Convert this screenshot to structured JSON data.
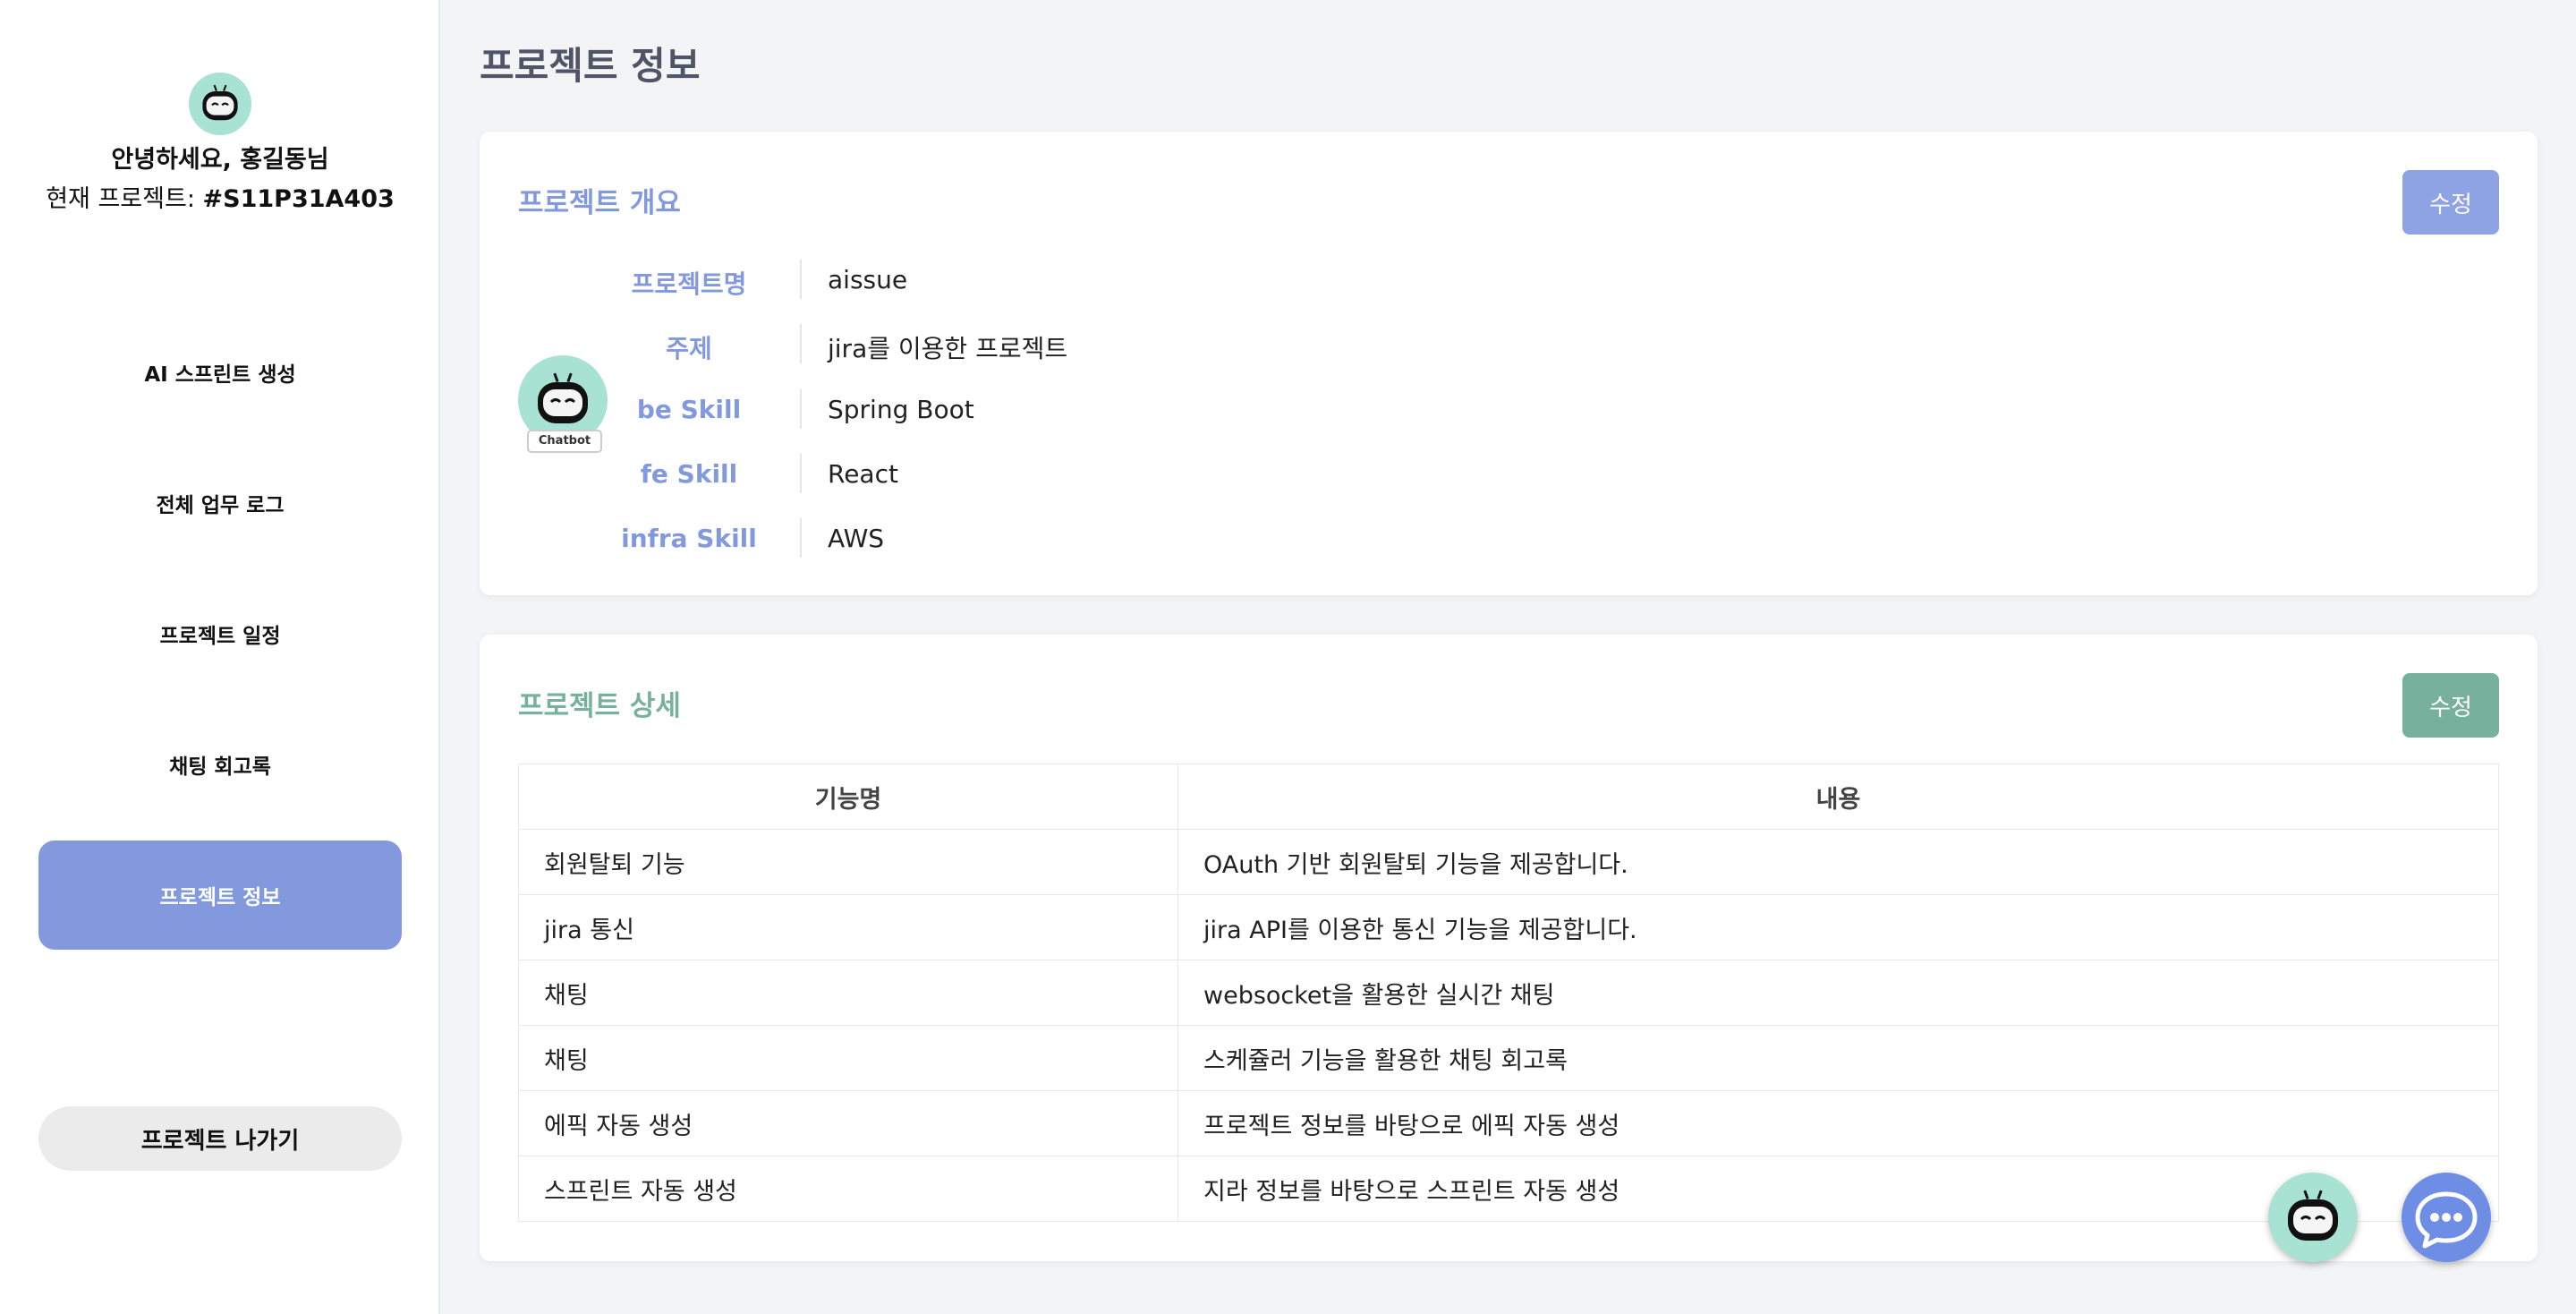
{
  "sidebar": {
    "greeting": "안녕하세요, 홍길동님",
    "project_prefix": "현재 프로젝트: ",
    "project_code": "#S11P31A403",
    "nav": [
      {
        "label": "AI 스프린트 생성",
        "active": false
      },
      {
        "label": "전체 업무 로그",
        "active": false
      },
      {
        "label": "프로젝트 일정",
        "active": false
      },
      {
        "label": "채팅 회고록",
        "active": false
      },
      {
        "label": "프로젝트 정보",
        "active": true
      }
    ],
    "leave_label": "프로젝트 나가기"
  },
  "page": {
    "title": "프로젝트 정보"
  },
  "overview": {
    "title": "프로젝트 개요",
    "edit_label": "수정",
    "badge_label": "Chatbot",
    "rows": [
      {
        "label": "프로젝트명",
        "value": "aissue"
      },
      {
        "label": "주제",
        "value": "jira를 이용한 프로젝트"
      },
      {
        "label": "be Skill",
        "value": "Spring Boot"
      },
      {
        "label": "fe Skill",
        "value": "React"
      },
      {
        "label": "infra Skill",
        "value": "AWS"
      }
    ]
  },
  "detail": {
    "title": "프로젝트 상세",
    "edit_label": "수정",
    "headers": [
      "기능명",
      "내용"
    ],
    "rows": [
      [
        "회원탈퇴 기능",
        "OAuth 기반 회원탈퇴 기능을 제공합니다."
      ],
      [
        "jira 통신",
        "jira API를 이용한 통신 기능을 제공합니다."
      ],
      [
        "채팅",
        "websocket을 활용한 실시간 채팅"
      ],
      [
        "채팅",
        "스케쥴러 기능을 활용한 채팅 회고록"
      ],
      [
        "에픽 자동 생성",
        "프로젝트 정보를 바탕으로 에픽 자동 생성"
      ],
      [
        "스프린트 자동 생성",
        "지라 정보를 바탕으로 스프린트 자동 생성"
      ]
    ]
  },
  "icons": {
    "avatar": "robot-face-icon",
    "chatbot_fab": "robot-face-icon",
    "chat_fab": "chat-bubble-icon"
  },
  "colors": {
    "accent_blue": "#8399de",
    "accent_green": "#77b19e",
    "mint": "#a8e2d2"
  }
}
